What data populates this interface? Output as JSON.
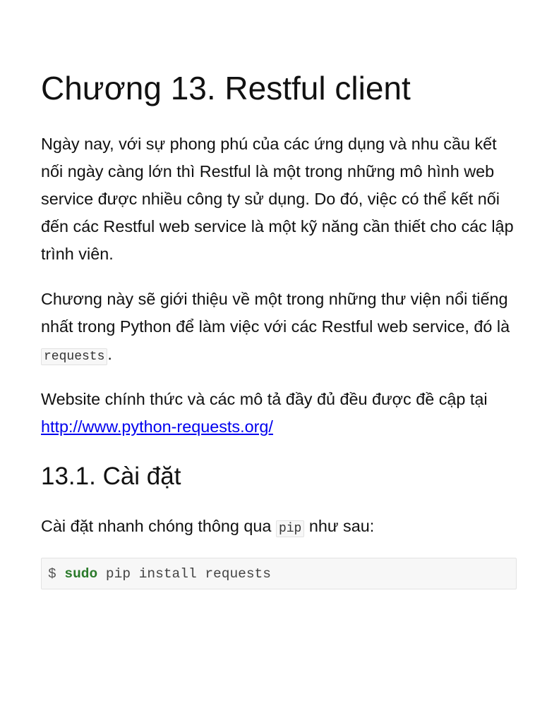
{
  "chapter": {
    "title": "Chương 13. Restful client",
    "intro_paragraphs": [
      "Ngày nay, với sự phong phú của các ứng dụng và nhu cầu kết nối ngày càng lớn thì Restful là một trong những mô hình web service được nhiều công ty sử dụng. Do đó, việc có thể kết nối đến các Restful web service là một kỹ năng cần thiết cho các lập trình viên."
    ],
    "library_paragraph": {
      "before": "Chương này sẽ giới thiệu về một trong những thư viện nổi tiếng nhất trong Python để làm việc với các Restful web service, đó là ",
      "code": "requests",
      "after": "."
    },
    "website_paragraph": {
      "before": "Website chính thức và các mô tả đầy đủ đều được đề cập tại ",
      "link": "http://www.python-requests.org/"
    }
  },
  "section": {
    "title": "13.1. Cài đặt",
    "install_text": {
      "before": "Cài đặt nhanh chóng thông qua ",
      "code": "pip",
      "after": " như sau:"
    },
    "code_block": {
      "prompt": "$ ",
      "command": "sudo",
      "rest": " pip install requests"
    }
  }
}
